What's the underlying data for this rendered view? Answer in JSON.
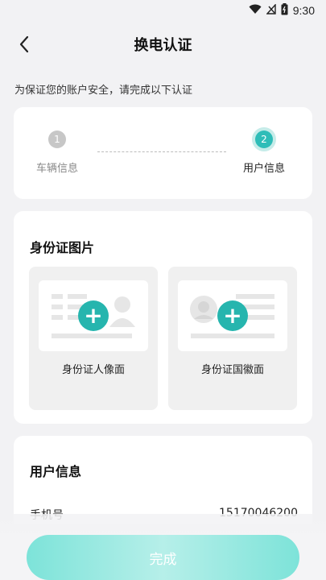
{
  "status": {
    "time": "9:30",
    "icons": [
      "wifi-icon",
      "signal-icon",
      "battery-icon"
    ]
  },
  "header": {
    "title": "换电认证",
    "back_icon": "chevron-left-icon"
  },
  "notice": "为保证您的账户安全，请完成以下认证",
  "steps": [
    {
      "number": "1",
      "label": "车辆信息",
      "active": false
    },
    {
      "number": "2",
      "label": "用户信息",
      "active": true
    }
  ],
  "id_section": {
    "title": "身份证图片",
    "front_label": "身份证人像面",
    "back_label": "身份证国徽面"
  },
  "user_section": {
    "title": "用户信息",
    "phone_label": "手机号",
    "phone_value": "15170046200"
  },
  "footer": {
    "button_label": "完成"
  },
  "colors": {
    "accent": "#26b5ae",
    "step_active": "#2fbdb8",
    "button": "#8fe6dd"
  }
}
